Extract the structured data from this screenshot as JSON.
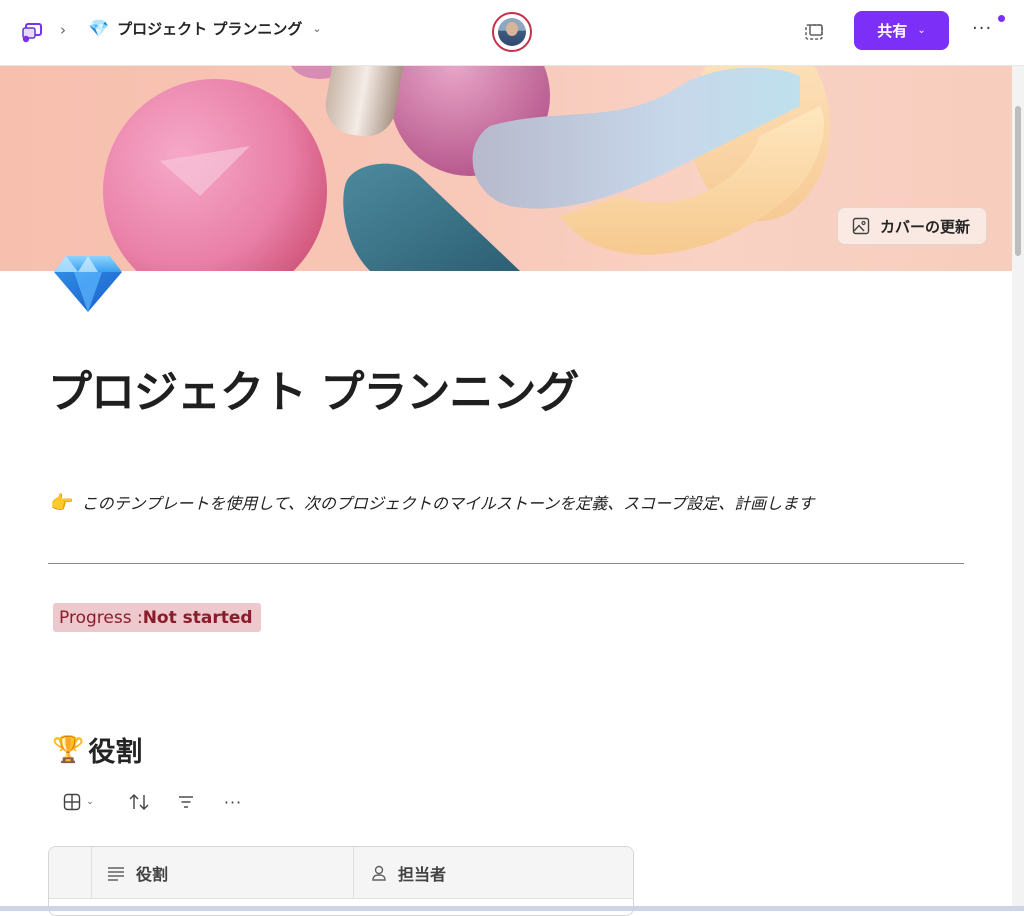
{
  "topbar": {
    "breadcrumb_separator": "›",
    "page_title": "プロジェクト プランニング",
    "page_emoji": "💎",
    "share_label": "共有",
    "more_label": "···"
  },
  "cover": {
    "update_label": "カバーの更新"
  },
  "page": {
    "title": "プロジェクト プランニング",
    "intro_emoji": "👉",
    "intro_text": "このテンプレートを使用して、次のプロジェクトのマイルストーンを定義、スコープ設定、計画します",
    "progress_label": "Progress : ",
    "progress_value": "Not started"
  },
  "section": {
    "emoji": "🏆",
    "title": "役割"
  },
  "table": {
    "columns": [
      "役割",
      "担当者"
    ]
  },
  "colors": {
    "accent": "#7b2ff7",
    "progress_bg": "#edc8cc",
    "progress_text": "#8a1c2b",
    "avatar_ring": "#c4314b"
  }
}
